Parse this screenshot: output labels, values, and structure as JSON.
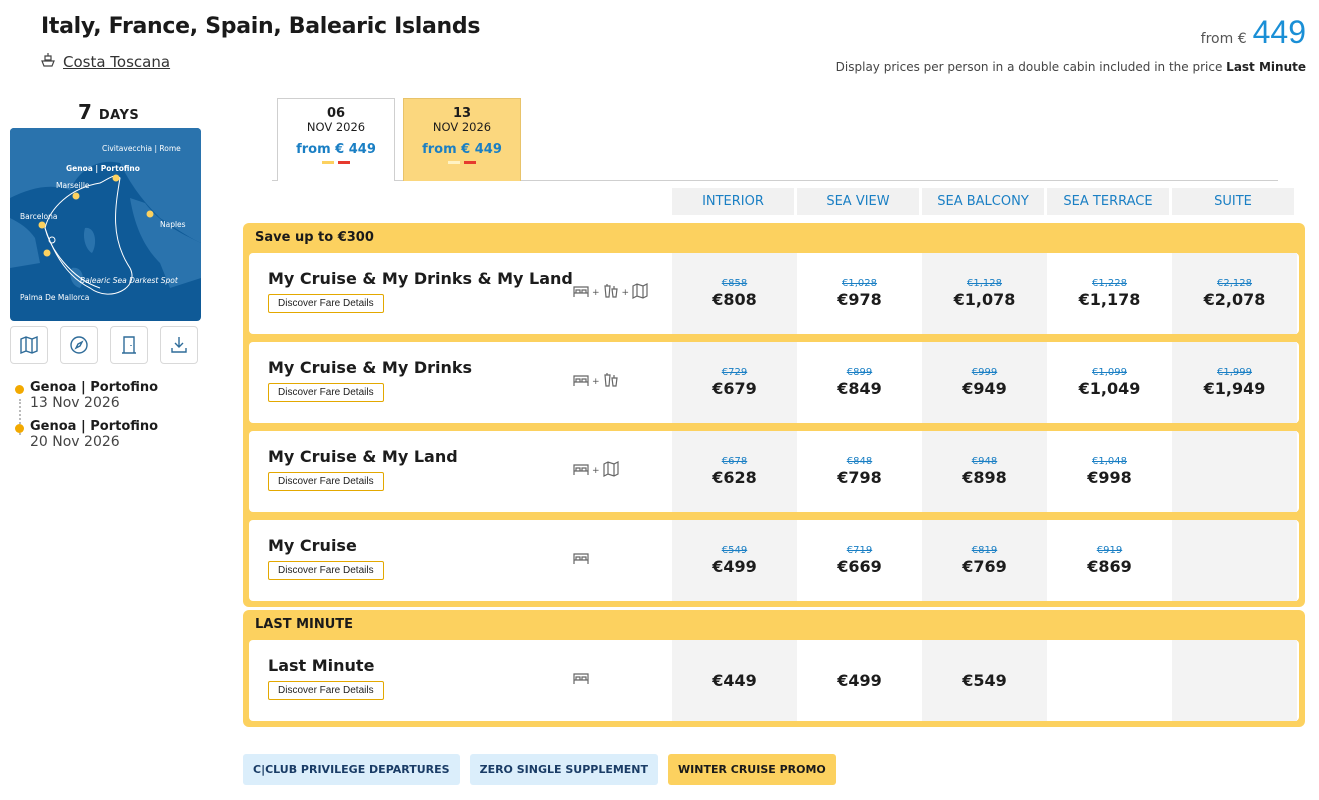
{
  "header": {
    "title": "Italy, France, Spain, Balearic Islands",
    "ship": "Costa Toscana",
    "from_label": "from €",
    "from_price": "449",
    "price_note": "Display prices per person in a double cabin included in the price",
    "price_note_bold": "Last Minute"
  },
  "sidebar": {
    "days_number": "7",
    "days_label": "DAYS",
    "map_labels": [
      "Civitavecchia | Rome",
      "Genoa | Portofino",
      "Marseille",
      "Barcelona",
      "Naples",
      "Balearic Sea Darkest Spot",
      "Palma De Mallorca"
    ],
    "tools": [
      "map-icon",
      "compass-icon",
      "door-icon",
      "download-icon"
    ],
    "itinerary": [
      {
        "port": "Genoa | Portofino",
        "date": "13 Nov 2026"
      },
      {
        "port": "Genoa | Portofino",
        "date": "20 Nov 2026"
      }
    ]
  },
  "date_tabs": [
    {
      "day": "06",
      "month": "NOV 2026",
      "from": "from € 449",
      "active": false
    },
    {
      "day": "13",
      "month": "NOV 2026",
      "from": "from € 449",
      "active": true
    }
  ],
  "cabins": [
    "INTERIOR",
    "SEA VIEW",
    "SEA BALCONY",
    "SEA TERRACE",
    "SUITE"
  ],
  "groups": [
    {
      "title": "Save up to €300",
      "fares": [
        {
          "name": "My Cruise & My Drinks & My Land",
          "button": "Discover Fare Details",
          "icons": [
            "bed-icon",
            "drinks-icon",
            "land-icon"
          ],
          "prices": [
            {
              "old": "€858",
              "new": "€808"
            },
            {
              "old": "€1,028",
              "new": "€978"
            },
            {
              "old": "€1,128",
              "new": "€1,078"
            },
            {
              "old": "€1,228",
              "new": "€1,178"
            },
            {
              "old": "€2,128",
              "new": "€2,078"
            }
          ]
        },
        {
          "name": "My Cruise & My Drinks",
          "button": "Discover Fare Details",
          "icons": [
            "bed-icon",
            "drinks-icon"
          ],
          "prices": [
            {
              "old": "€729",
              "new": "€679"
            },
            {
              "old": "€899",
              "new": "€849"
            },
            {
              "old": "€999",
              "new": "€949"
            },
            {
              "old": "€1,099",
              "new": "€1,049"
            },
            {
              "old": "€1,999",
              "new": "€1,949"
            }
          ]
        },
        {
          "name": "My Cruise & My Land",
          "button": "Discover Fare Details",
          "icons": [
            "bed-icon",
            "land-icon"
          ],
          "prices": [
            {
              "old": "€678",
              "new": "€628"
            },
            {
              "old": "€848",
              "new": "€798"
            },
            {
              "old": "€948",
              "new": "€898"
            },
            {
              "old": "€1,048",
              "new": "€998"
            },
            {
              "old": "",
              "new": ""
            }
          ]
        },
        {
          "name": "My Cruise",
          "button": "Discover Fare Details",
          "icons": [
            "bed-icon"
          ],
          "prices": [
            {
              "old": "€549",
              "new": "€499"
            },
            {
              "old": "€719",
              "new": "€669"
            },
            {
              "old": "€819",
              "new": "€769"
            },
            {
              "old": "€919",
              "new": "€869"
            },
            {
              "old": "",
              "new": ""
            }
          ]
        }
      ]
    },
    {
      "title": "LAST MINUTE",
      "fares": [
        {
          "name": "Last Minute",
          "button": "Discover Fare Details",
          "icons": [
            "bed-icon"
          ],
          "prices": [
            {
              "old": "",
              "new": "€449"
            },
            {
              "old": "",
              "new": "€499"
            },
            {
              "old": "",
              "new": "€549"
            },
            {
              "old": "",
              "new": ""
            },
            {
              "old": "",
              "new": ""
            }
          ]
        }
      ]
    }
  ],
  "badges": [
    {
      "label": "C|CLUB PRIVILEGE DEPARTURES",
      "style": "blue"
    },
    {
      "label": "ZERO SINGLE SUPPLEMENT",
      "style": "blue"
    },
    {
      "label": "WINTER CRUISE PROMO",
      "style": "yellow"
    }
  ],
  "colors": {
    "accent_blue": "#1a8fd6",
    "promo_yellow": "#fcd15f",
    "map_sea": "#0f5a97",
    "dot": "#f2a900"
  }
}
